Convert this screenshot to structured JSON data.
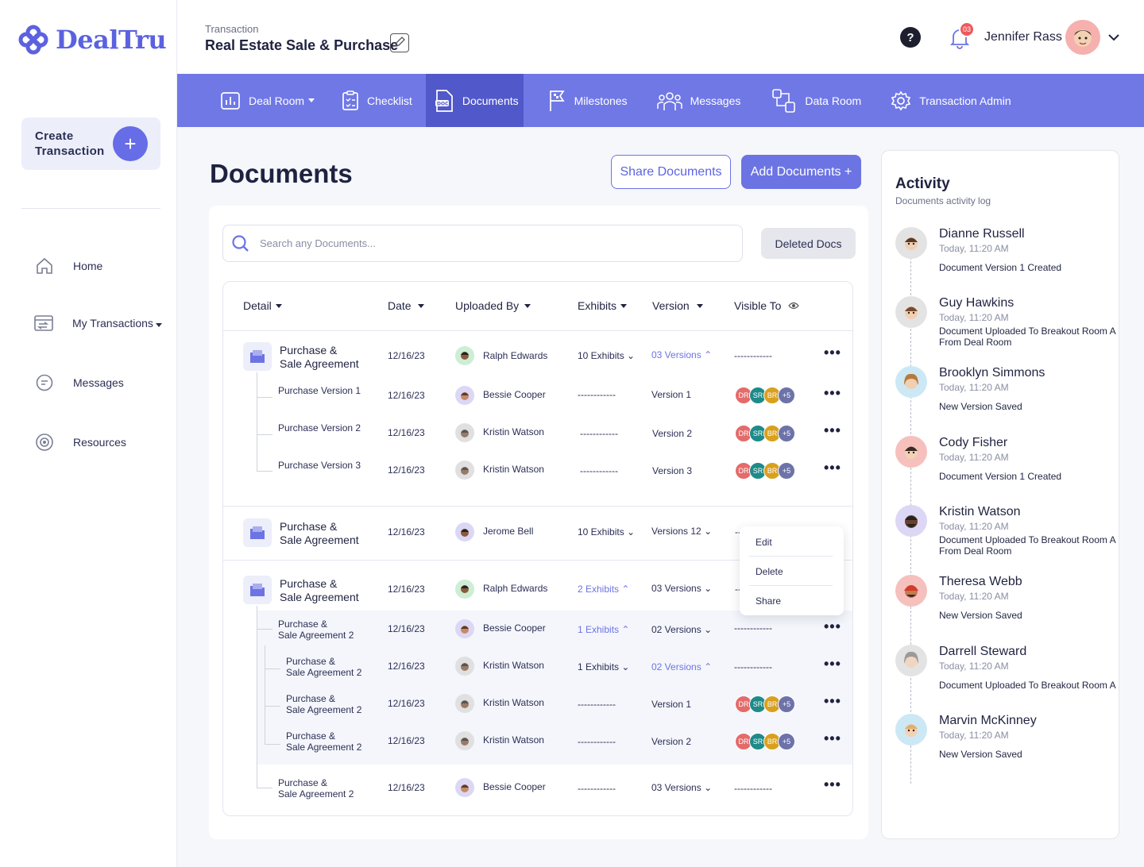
{
  "brand": {
    "name": "DealTru"
  },
  "sidebar": {
    "create_label": "Create Transaction",
    "items": [
      {
        "label": "Home",
        "icon": "home-icon"
      },
      {
        "label": "My Transactions",
        "icon": "transactions-icon"
      },
      {
        "label": "Messages",
        "icon": "messages-icon"
      },
      {
        "label": "Resources",
        "icon": "resources-icon"
      }
    ]
  },
  "header": {
    "crumb": "Transaction",
    "title": "Real Estate Sale & Purchase",
    "user_name": "Jennifer Rass",
    "notification_count": "03",
    "help": "?"
  },
  "tabs": [
    {
      "label": "Deal Room"
    },
    {
      "label": "Checklist"
    },
    {
      "label": "Documents",
      "active": true
    },
    {
      "label": "Milestones"
    },
    {
      "label": "Messages"
    },
    {
      "label": "Data Room"
    },
    {
      "label": "Transaction Admin"
    }
  ],
  "page": {
    "title": "Documents",
    "share_label": "Share Documents",
    "add_label": "Add Documents +",
    "search_placeholder": "Search any Documents...",
    "deleted_label": "Deleted Docs"
  },
  "columns": {
    "detail": "Detail",
    "date": "Date",
    "uploaded_by": "Uploaded By",
    "exhibits": "Exhibits",
    "version": "Version",
    "visible_to": "Visible To"
  },
  "rows": {
    "r1": {
      "name1": "Purchase &",
      "name2": "Sale Agreement",
      "date": "12/16/23",
      "user": "Ralph Edwards",
      "exhibits": "10 Exhibits",
      "version": "03 Versions",
      "visible": "------------"
    },
    "r1a": {
      "name": "Purchase Version 1",
      "date": "12/16/23",
      "user": "Bessie Cooper",
      "exhibits": "------------",
      "version": "Version 1"
    },
    "r1b": {
      "name": "Purchase Version 2",
      "date": "12/16/23",
      "user": "Kristin Watson",
      "exhibits": "------------",
      "version": "Version 2"
    },
    "r1c": {
      "name": "Purchase Version 3",
      "date": "12/16/23",
      "user": "Kristin Watson",
      "exhibits": "------------",
      "version": "Version 3"
    },
    "r2": {
      "name1": "Purchase &",
      "name2": "Sale Agreement",
      "date": "12/16/23",
      "user": "Jerome Bell",
      "exhibits": "10 Exhibits",
      "version": "Versions 12",
      "visible": "--"
    },
    "r3": {
      "name1": "Purchase &",
      "name2": "Sale Agreement",
      "date": "12/16/23",
      "user": "Ralph Edwards",
      "exhibits": "2 Exhibits",
      "version": "03 Versions",
      "visible": "--"
    },
    "r3a": {
      "name1": "Purchase &",
      "name2": "Sale Agreement 2",
      "date": "12/16/23",
      "user": "Bessie Cooper",
      "exhibits": "1 Exhibits",
      "version": "02 Versions",
      "visible": "------------"
    },
    "r3b": {
      "name1": "Purchase &",
      "name2": "Sale Agreement 2",
      "date": "12/16/23",
      "user": "Kristin Watson",
      "exhibits": "1 Exhibits",
      "version": "02 Versions",
      "visible": "------------"
    },
    "r3c": {
      "name1": "Purchase &",
      "name2": "Sale Agreement 2",
      "date": "12/16/23",
      "user": "Kristin Watson",
      "exhibits": "------------",
      "version": "Version 1"
    },
    "r3d": {
      "name1": "Purchase &",
      "name2": "Sale Agreement 2",
      "date": "12/16/23",
      "user": "Kristin Watson",
      "exhibits": "------------",
      "version": "Version 2"
    },
    "r3e": {
      "name1": "Purchase &",
      "name2": "Sale Agreement 2",
      "date": "12/16/23",
      "user": "Bessie Cooper",
      "exhibits": "------------",
      "version": "03 Versions",
      "visible": "------------"
    }
  },
  "chips": {
    "a": "DR",
    "b": "SR",
    "c": "BR",
    "d": "+5"
  },
  "menu": {
    "edit": "Edit",
    "delete": "Delete",
    "share": "Share"
  },
  "activity": {
    "title": "Activity",
    "subtitle": "Documents activity log",
    "items": [
      {
        "name": "Dianne Russell",
        "time": "Today, 11:20 AM",
        "desc": "Document Version 1 Created"
      },
      {
        "name": "Guy Hawkins",
        "time": "Today, 11:20 AM",
        "desc": "Document Uploaded To Breakout Room A From Deal Room"
      },
      {
        "name": "Brooklyn Simmons",
        "time": "Today, 11:20 AM",
        "desc": "New Version Saved"
      },
      {
        "name": "Cody Fisher",
        "time": "Today, 11:20 AM",
        "desc": "Document Version 1 Created"
      },
      {
        "name": "Kristin Watson",
        "time": "Today, 11:20 AM",
        "desc": "Document Uploaded To Breakout Room A From Deal Room"
      },
      {
        "name": "Theresa Webb",
        "time": "Today, 11:20 AM",
        "desc": "New Version Saved"
      },
      {
        "name": "Darrell Steward",
        "time": "Today, 11:20 AM",
        "desc": "Document Uploaded To Breakout Room A"
      },
      {
        "name": "Marvin McKinney",
        "time": "Today, 11:20 AM",
        "desc": "New Version Saved"
      }
    ]
  },
  "colors": {
    "accent": "#6c74e4",
    "tabbar": "#7078e6",
    "chip_dr": "#e46b6b",
    "chip_sr": "#1f8a8a",
    "chip_br": "#d9a01e",
    "chip_more": "#6d73a8"
  }
}
